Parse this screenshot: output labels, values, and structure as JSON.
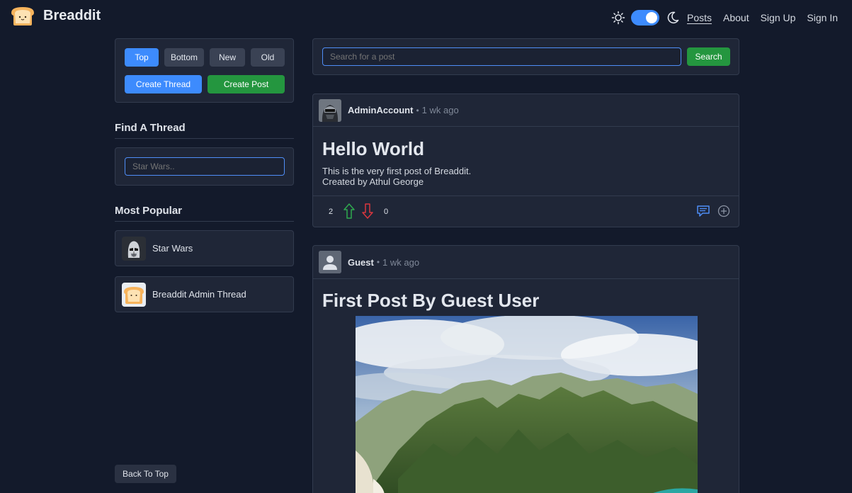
{
  "brand": {
    "name": "Breaddit"
  },
  "nav": {
    "links": [
      "Posts",
      "About",
      "Sign Up",
      "Sign In"
    ]
  },
  "sort": {
    "top": "Top",
    "bottom": "Bottom",
    "new": "New",
    "old": "Old"
  },
  "actions": {
    "create_thread": "Create Thread",
    "create_post": "Create Post"
  },
  "find_thread": {
    "title": "Find A Thread",
    "placeholder": "Star Wars.."
  },
  "most_popular": {
    "title": "Most Popular",
    "items": [
      {
        "label": "Star Wars",
        "icon": "stormtrooper-avatar"
      },
      {
        "label": "Breaddit Admin Thread",
        "icon": "bread-avatar"
      }
    ]
  },
  "search": {
    "placeholder": "Search for a post",
    "button": "Search"
  },
  "posts": [
    {
      "author": "AdminAccount",
      "separator": "•",
      "time": "1 wk ago",
      "title": "Hello World",
      "body": [
        "This is the very first post of Breaddit.",
        "Created by Athul George"
      ],
      "upvotes": "2",
      "downvotes": "0"
    },
    {
      "author": "Guest",
      "separator": "•",
      "time": "1 wk ago",
      "title": "First Post By Guest User",
      "image": "mountain-coastline-photo"
    }
  ],
  "footer": {
    "back_to_top": "Back To Top"
  },
  "colors": {
    "background": "#131a2b",
    "panel": "#1f2637",
    "accent_blue": "#3d8bfd",
    "accent_green": "#24963f",
    "upvote": "#2fa84f",
    "downvote": "#d9363e"
  }
}
